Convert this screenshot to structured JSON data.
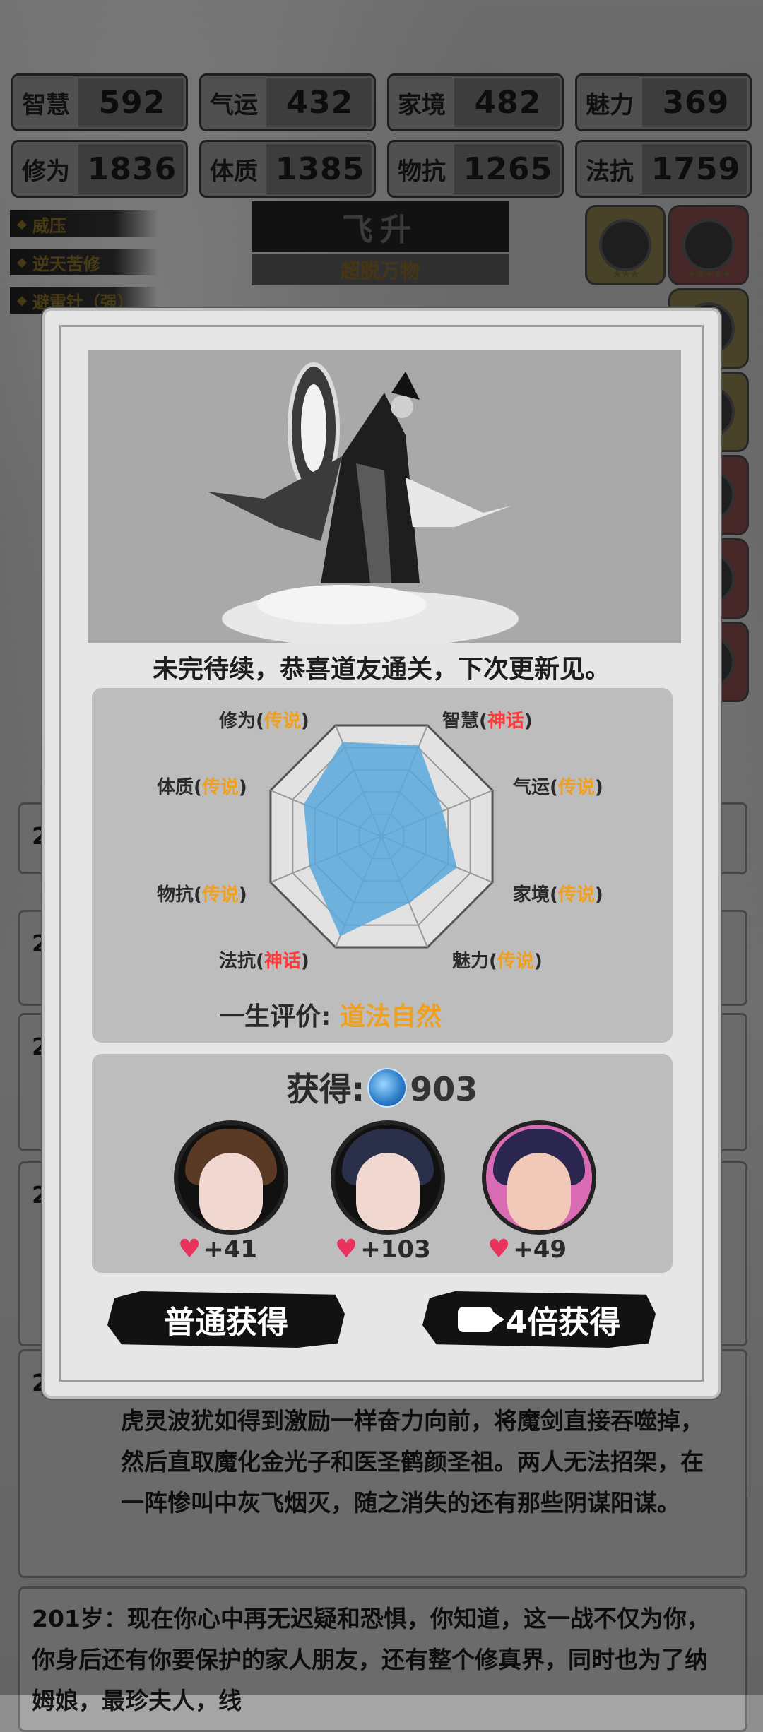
{
  "stats_row1": [
    {
      "name": "智慧",
      "value": "592"
    },
    {
      "name": "气运",
      "value": "432"
    },
    {
      "name": "家境",
      "value": "482"
    },
    {
      "name": "魅力",
      "value": "369"
    }
  ],
  "stats_row2": [
    {
      "name": "修为",
      "value": "1836"
    },
    {
      "name": "体质",
      "value": "1385"
    },
    {
      "name": "物抗",
      "value": "1265"
    },
    {
      "name": "法抗",
      "value": "1759"
    }
  ],
  "tags": [
    "威压",
    "逆天苦修",
    "避雷针（强）"
  ],
  "title_banner": "飞升",
  "subtitle": "超脱万物",
  "log_age_prefix": "2",
  "log_text_1": "虎灵波犹如得到激励一样奋力向前，将魔剑直接吞噬掉，然后直取魔化金光子和医圣鹤颜圣祖。两人无法招架，在一阵惨叫中灰飞烟灭，随之消失的还有那些阴谋阳谋。",
  "log_age_2": "201岁：",
  "log_text_2": "现在你心中再无迟疑和恐惧，你知道，这一战不仅为你，你身后还有你要保护的家人朋友，还有整个修真界，同时也为了纳姆娘，最珍夫人，线",
  "modal": {
    "message": "未完待续，恭喜道友通关，下次更新见。",
    "radar": {
      "labels": [
        {
          "attr": "修为",
          "grade": "传说",
          "tier": "legend"
        },
        {
          "attr": "智慧",
          "grade": "神话",
          "tier": "myth"
        },
        {
          "attr": "气运",
          "grade": "传说",
          "tier": "legend"
        },
        {
          "attr": "家境",
          "grade": "传说",
          "tier": "legend"
        },
        {
          "attr": "魅力",
          "grade": "传说",
          "tier": "legend"
        },
        {
          "attr": "法抗",
          "grade": "神话",
          "tier": "myth"
        },
        {
          "attr": "物抗",
          "grade": "传说",
          "tier": "legend"
        },
        {
          "attr": "体质",
          "grade": "传说",
          "tier": "legend"
        }
      ],
      "levels": [
        0.85,
        0.82,
        0.55,
        0.68,
        0.6,
        0.9,
        0.65,
        0.7
      ]
    },
    "verdict_label": "一生评价:",
    "verdict_value": "道法自然",
    "reward_label": "获得:",
    "reward_amount": "903",
    "affections": [
      "+41",
      "+103",
      "+49"
    ],
    "btn_normal": "普通获得",
    "btn_video": "4倍获得"
  },
  "colors": {
    "legend": "#f0a020",
    "myth": "#ff3a3a",
    "radar_fill": "#5aa8dc"
  }
}
